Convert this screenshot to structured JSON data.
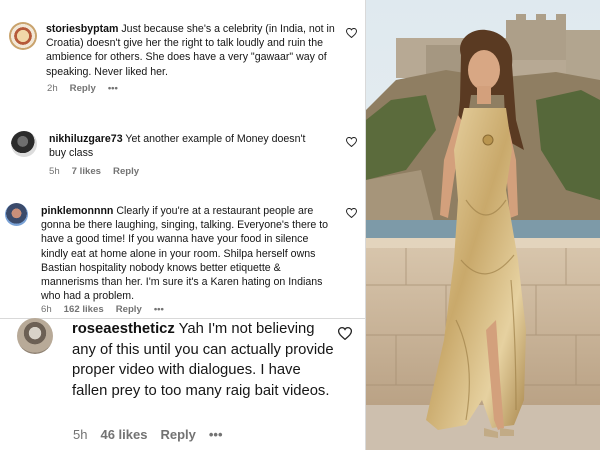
{
  "comments": [
    {
      "username": "storiesbyptam",
      "text": "Just because she's a celebrity (in India, not in Croatia) doesn't give her the right to talk loudly and ruin the ambience for others. She does have a very \"gawaar\" way of speaking. Never liked her.",
      "time": "2h",
      "reply_label": "Reply",
      "more_label": "•••"
    },
    {
      "username": "nikhiluzgare73",
      "text": "Yet another example of Money doesn't buy class",
      "time": "5h",
      "likes": "7 likes",
      "reply_label": "Reply"
    },
    {
      "username": "pinklemonnnn",
      "text": "Clearly if you're at a restaurant people are gonna be there laughing, singing, talking. Everyone's there to have a good time! If you wanna have your food in silence kindly eat at home alone in your room. Shilpa herself owns Bastian hospitality nobody knows better etiquette & mannerisms than her. I'm sure it's a Karen hating on Indians who had a problem.",
      "time": "6h",
      "likes": "162 likes",
      "reply_label": "Reply",
      "more_label": "•••"
    },
    {
      "username": "roseaestheticz",
      "text": "Yah I'm not believing any of this until you can actually provide proper video with dialogues. I have fallen prey to too many raig bait videos.",
      "time": "5h",
      "likes": "46 likes",
      "reply_label": "Reply",
      "more_label": "•••"
    }
  ],
  "icons": [
    "heart-icon",
    "more-icon"
  ],
  "colors": {
    "meta_text": "#737373",
    "body_text": "#161616",
    "background": "#ffffff"
  }
}
